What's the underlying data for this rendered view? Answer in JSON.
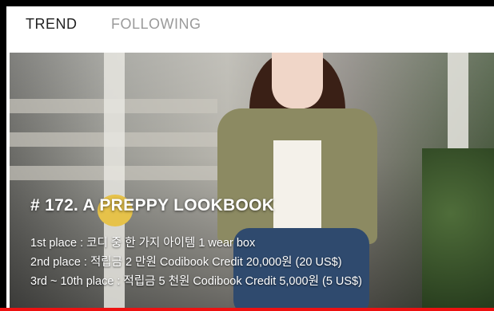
{
  "tabs": [
    {
      "label": "TREND",
      "active": true
    },
    {
      "label": "FOLLOWING",
      "active": false
    }
  ],
  "banner": {
    "title": "# 172.  A PREPPY LOOKBOOK",
    "lines": [
      "1st place : 코디 중 한 가지 아이템 1 wear box",
      "2nd place : 적립금 2 만원 Codibook Credit 20,000원 (20 US$)",
      "3rd ~ 10th place : 적립금 5 천원 Codibook Credit 5,000원 (5 US$)"
    ]
  },
  "colors": {
    "accent": "#e11111",
    "active_tab": "#222222",
    "inactive_tab": "#9a9a9a"
  }
}
